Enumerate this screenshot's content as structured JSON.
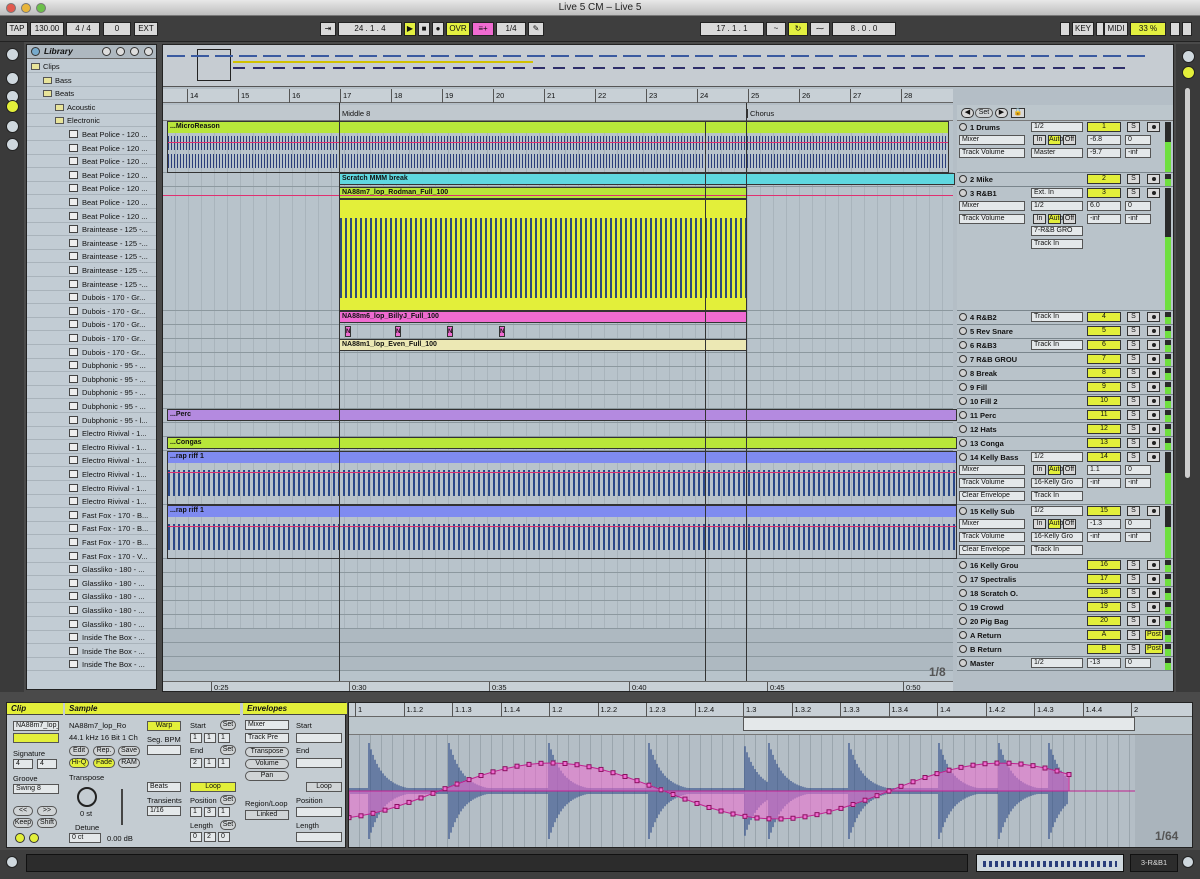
{
  "window": {
    "title": "Live 5 CM – Live 5"
  },
  "transport": {
    "tap": "TAP",
    "tempo": "130.00",
    "signature": "4 / 4",
    "metro": "0",
    "ext": "EXT",
    "position": "24 . 1 . 4",
    "ovr": "OVR",
    "quant": "1/4",
    "loop_start": "17 . 1 . 1",
    "loop_len": "8 . 0 . 0",
    "key": "KEY",
    "midi": "MIDI",
    "cpu": "33 %"
  },
  "browser": {
    "title": "Library",
    "items": [
      {
        "label": "Clips",
        "type": "folder",
        "indent": 0
      },
      {
        "label": "Bass",
        "type": "folder",
        "indent": 1
      },
      {
        "label": "Beats",
        "type": "folder",
        "indent": 1
      },
      {
        "label": "Acoustic",
        "type": "folder",
        "indent": 2
      },
      {
        "label": "Electronic",
        "type": "folder",
        "indent": 2
      },
      {
        "label": "Beat Police - 120 ...",
        "type": "clip"
      },
      {
        "label": "Beat Police - 120 ...",
        "type": "clip"
      },
      {
        "label": "Beat Police - 120 ...",
        "type": "clip"
      },
      {
        "label": "Beat Police - 120 ...",
        "type": "clip"
      },
      {
        "label": "Beat Police - 120 ...",
        "type": "clip"
      },
      {
        "label": "Beat Police - 120 ...",
        "type": "clip"
      },
      {
        "label": "Beat Police - 120 ...",
        "type": "clip"
      },
      {
        "label": "Braintease - 125 -...",
        "type": "clip"
      },
      {
        "label": "Braintease - 125 -...",
        "type": "clip"
      },
      {
        "label": "Braintease - 125 -...",
        "type": "clip"
      },
      {
        "label": "Braintease - 125 -...",
        "type": "clip"
      },
      {
        "label": "Braintease - 125 -...",
        "type": "clip"
      },
      {
        "label": "Dubois - 170 - Gr...",
        "type": "clip"
      },
      {
        "label": "Dubois - 170 - Gr...",
        "type": "clip"
      },
      {
        "label": "Dubois - 170 - Gr...",
        "type": "clip"
      },
      {
        "label": "Dubois - 170 - Gr...",
        "type": "clip"
      },
      {
        "label": "Dubois - 170 - Gr...",
        "type": "clip"
      },
      {
        "label": "Dubphonic - 95 - ...",
        "type": "clip"
      },
      {
        "label": "Dubphonic - 95 - ...",
        "type": "clip"
      },
      {
        "label": "Dubphonic - 95 - ...",
        "type": "clip"
      },
      {
        "label": "Dubphonic - 95 - ...",
        "type": "clip"
      },
      {
        "label": "Dubphonic - 95 - l...",
        "type": "clip"
      },
      {
        "label": "Electro Rivival - 1...",
        "type": "clip"
      },
      {
        "label": "Electro Rivival - 1...",
        "type": "clip"
      },
      {
        "label": "Electro Rivival - 1...",
        "type": "clip"
      },
      {
        "label": "Electro Rivival - 1...",
        "type": "clip"
      },
      {
        "label": "Electro Rivival - 1...",
        "type": "clip"
      },
      {
        "label": "Electro Rivival - 1...",
        "type": "clip"
      },
      {
        "label": "Fast Fox - 170 - B...",
        "type": "clip"
      },
      {
        "label": "Fast Fox - 170 - B...",
        "type": "clip"
      },
      {
        "label": "Fast Fox - 170 - B...",
        "type": "clip"
      },
      {
        "label": "Fast Fox - 170 - V...",
        "type": "clip"
      },
      {
        "label": "Glassliko - 180 - ...",
        "type": "clip"
      },
      {
        "label": "Glassliko - 180 - ...",
        "type": "clip"
      },
      {
        "label": "Glassliko - 180 - ...",
        "type": "clip"
      },
      {
        "label": "Glassliko - 180 - ...",
        "type": "clip"
      },
      {
        "label": "Glassliko - 180 - ...",
        "type": "clip"
      },
      {
        "label": "Inside The Box - ...",
        "type": "clip"
      },
      {
        "label": "Inside The Box - ...",
        "type": "clip"
      },
      {
        "label": "Inside The Box - ...",
        "type": "clip"
      }
    ]
  },
  "ruler": {
    "bars": [
      "14",
      "15",
      "16",
      "17",
      "18",
      "19",
      "20",
      "21",
      "22",
      "23",
      "24",
      "25",
      "26",
      "27",
      "28"
    ],
    "locators": [
      "Middle 8",
      "Chorus"
    ],
    "set_label": "Set",
    "times": [
      "0:25",
      "0:30",
      "0:35",
      "0:40",
      "0:45",
      "0:50"
    ],
    "zoom": "1/8"
  },
  "clips": {
    "microreason": "...MicroReason",
    "scratch": "Scratch MMM break",
    "rodman": "NA88m7_lop_Rodman_Full_100",
    "billyj": "NA88m6_lop_BillyJ_Full_100",
    "even": "NA88m1_lop_Even_Full_100",
    "perc": "...Perc",
    "congas": "...Congas",
    "rap1": "...rap riff 1",
    "rap2": "...rap riff 1",
    "midi_note": "N"
  },
  "tracks": [
    {
      "name": "1 Drums",
      "num": "1",
      "io": [
        "1/2",
        "Mixer",
        "Track Volume",
        "Master"
      ],
      "vals": [
        "-6.8",
        "0",
        "-9.7",
        "-inf"
      ]
    },
    {
      "name": "2 Mike",
      "num": "2"
    },
    {
      "name": "3 R&B1",
      "num": "3",
      "io": [
        "Ext. In",
        "1/2",
        "Mixer",
        "Track Volume",
        "7-R&B GRO",
        "Track In"
      ],
      "vals": [
        "6.0",
        "0",
        "-inf",
        "-inf"
      ]
    },
    {
      "name": "4 R&B2",
      "num": "4",
      "io": [
        "Track In"
      ]
    },
    {
      "name": "5 Rev Snare",
      "num": "5"
    },
    {
      "name": "6 R&B3",
      "num": "6",
      "io": [
        "Track In"
      ]
    },
    {
      "name": "7 R&B GROU",
      "num": "7"
    },
    {
      "name": "8 Break",
      "num": "8"
    },
    {
      "name": "9 Fill",
      "num": "9"
    },
    {
      "name": "10 Fill 2",
      "num": "10"
    },
    {
      "name": "11 Perc",
      "num": "11"
    },
    {
      "name": "12 Hats",
      "num": "12"
    },
    {
      "name": "13 Conga",
      "num": "13"
    },
    {
      "name": "14 Kelly Bass",
      "num": "14",
      "io": [
        "1/2",
        "Mixer",
        "Track Volume",
        "16-Kelly Gro",
        "Track In"
      ],
      "vals": [
        "1.1",
        "0",
        "-inf",
        "-inf"
      ],
      "env": "Clear Envelope"
    },
    {
      "name": "15 Kelly Sub",
      "num": "15",
      "io": [
        "1/2",
        "Mixer",
        "Track Volume",
        "16-Kelly Gro",
        "Track In"
      ],
      "vals": [
        "-1.3",
        "0",
        "-inf",
        "-inf"
      ],
      "env": "Clear Envelope"
    },
    {
      "name": "16 Kelly Grou",
      "num": "16"
    },
    {
      "name": "17 Spectralis",
      "num": "17"
    },
    {
      "name": "18 Scratch O.",
      "num": "18"
    },
    {
      "name": "19 Crowd",
      "num": "19"
    },
    {
      "name": "20 Pig Bag",
      "num": "20"
    },
    {
      "name": "A Return",
      "num": "A",
      "post": "Post"
    },
    {
      "name": "B Return",
      "num": "B",
      "post": "Post"
    },
    {
      "name": "Master",
      "num": "1/2",
      "vals": [
        "-13",
        "0"
      ]
    }
  ],
  "mixer_labels": {
    "in": "In",
    "auto": "Auto",
    "off": "Off",
    "solo": "S"
  },
  "clip_panel": {
    "title": "Clip",
    "name": "NA88m7_lop_Ro",
    "signature_label": "Signature",
    "sig_num": "4",
    "sig_den": "4",
    "groove_label": "Groove",
    "groove": "Swing 8",
    "keep": "Keep",
    "shift": "Shift"
  },
  "sample_panel": {
    "title": "Sample",
    "name": "NA88m7_lop_Ro",
    "info": "44.1 kHz 16 Bit 1 Ch",
    "edit": "Edit",
    "rep": "Rep.",
    "save": "Save",
    "hiq": "Hi-Q",
    "fade": "Fade",
    "ram": "RAM",
    "transpose_label": "Transpose",
    "transpose": "0 st",
    "detune_label": "Detune",
    "detune": "0 ct",
    "gain": "0.00 dB",
    "warp": "Warp",
    "seg_bpm": "Seg. BPM",
    "beats": "Beats",
    "transients_label": "Transients",
    "transients": "1/16",
    "start": "Start",
    "end": "End",
    "loop": "Loop",
    "position": "Position",
    "length": "Length",
    "set": "Set",
    "start_vals": [
      "1",
      "1",
      "1"
    ],
    "end_vals": [
      "2",
      "1",
      "1"
    ],
    "pos_vals": [
      "1",
      "3",
      "1"
    ],
    "len_vals": [
      "0",
      "2",
      "0"
    ]
  },
  "env_panel": {
    "title": "Envelopes",
    "dev": "Mixer",
    "ctrl": "Track Pre",
    "transpose": "Transpose",
    "volume": "Volume",
    "pan": "Pan",
    "region_loop": "Region/Loop",
    "linked": "Linked",
    "start": "Start",
    "end": "End",
    "loop": "Loop",
    "position": "Position",
    "length": "Length"
  },
  "sample_view": {
    "ruler": [
      "1",
      "1.1.2",
      "1.1.3",
      "1.1.4",
      "1.2",
      "1.2.2",
      "1.2.3",
      "1.2.4",
      "1.3",
      "1.3.2",
      "1.3.3",
      "1.3.4",
      "1.4",
      "1.4.2",
      "1.4.3",
      "1.4.4",
      "2"
    ],
    "zoom": "1/64"
  },
  "status": {
    "track": "3-R&B1"
  },
  "colors": {
    "yellow": "#e3ef3a",
    "pink": "#f06bd1",
    "cyan": "#5fd8e0",
    "purple": "#b48ae0",
    "green": "#b8e63a",
    "blue": "#7f8bf0",
    "beige": "#ece8b4",
    "orange": "#f2b23a"
  }
}
